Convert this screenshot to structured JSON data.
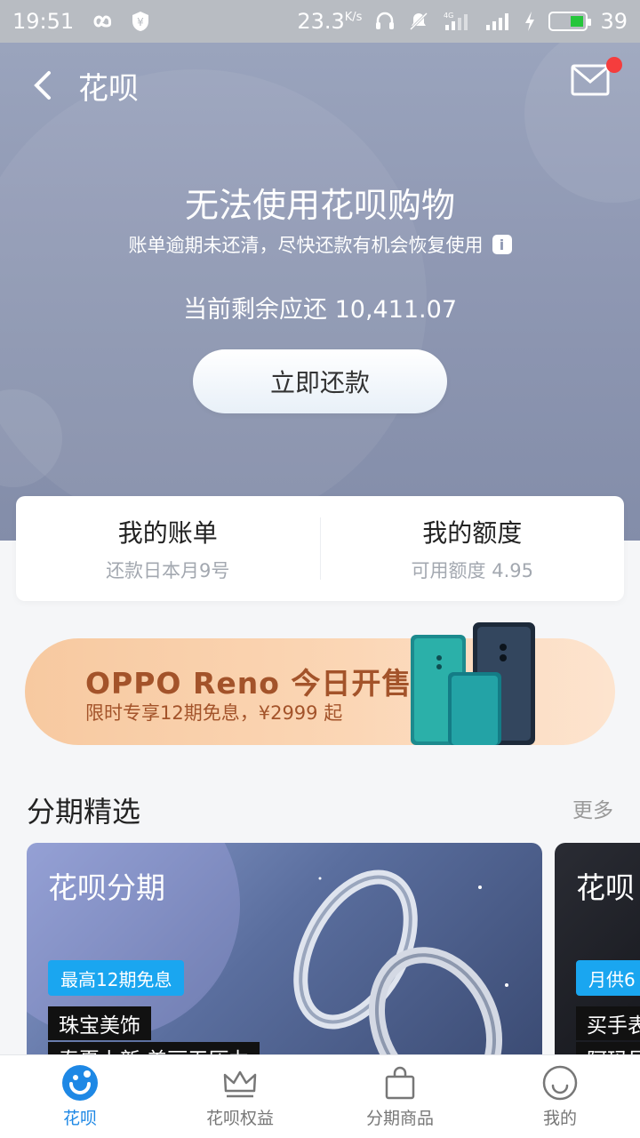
{
  "status_bar": {
    "time": "19:51",
    "speed": "23.3",
    "speed_unit": "K/s",
    "network": "4G",
    "battery": "39"
  },
  "nav": {
    "title": "花呗"
  },
  "hero": {
    "title": "无法使用花呗购物",
    "subtitle": "账单逾期未还清，尽快还款有机会恢复使用",
    "due_label": "当前剩余应还 10,411.07",
    "repay_button": "立即还款"
  },
  "summary": {
    "bill_title": "我的账单",
    "bill_sub": "还款日本月9号",
    "limit_title": "我的额度",
    "limit_sub": "可用额度 4.95"
  },
  "banner": {
    "title": "OPPO Reno 今日开售",
    "subtitle": "限时专享12期免息，¥2999 起"
  },
  "section": {
    "title": "分期精选",
    "more": "更多"
  },
  "products": [
    {
      "brand": "花呗分期",
      "badge": "最高12期免息",
      "name": "珠宝美饰",
      "desc": "春夏上新 美丽无压力"
    },
    {
      "brand": "花呗",
      "badge": "月供6",
      "name": "买手表",
      "desc": "阿玛尼"
    }
  ],
  "tabs": [
    {
      "label": "花呗",
      "icon": "huabei-logo-icon"
    },
    {
      "label": "花呗权益",
      "icon": "crown-icon"
    },
    {
      "label": "分期商品",
      "icon": "shopping-bag-icon"
    },
    {
      "label": "我的",
      "icon": "smiley-icon"
    }
  ],
  "colors": {
    "accent": "#1e88e5",
    "hero": "#8f98b3",
    "banner_text": "#a3532a",
    "badge": "#1aa6f0",
    "alert_dot": "#f53d3d"
  }
}
